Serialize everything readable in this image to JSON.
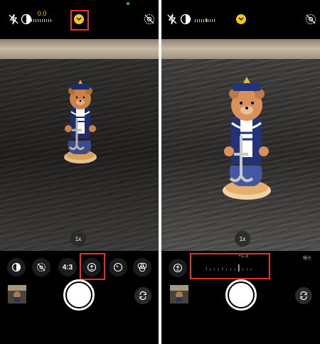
{
  "left": {
    "exposure_value": "0.0",
    "zoom": "1x",
    "aspect_ratio": "4:3"
  },
  "right": {
    "zoom": "1x",
    "exposure_dial_value": "+1.3",
    "exposure_dial_label": "曝光"
  },
  "icons": {
    "flash_off": "flash-off-icon",
    "night_mode": "night-mode-icon",
    "live_off": "live-photo-off-icon",
    "chevron": "chevron-down-icon",
    "timer": "timer-icon",
    "exposure": "exposure-icon",
    "filters": "filters-icon",
    "flip": "camera-flip-icon"
  },
  "colors": {
    "accent": "#f5c518",
    "highlight": "#e5312a",
    "indicator": "#31c24a"
  }
}
